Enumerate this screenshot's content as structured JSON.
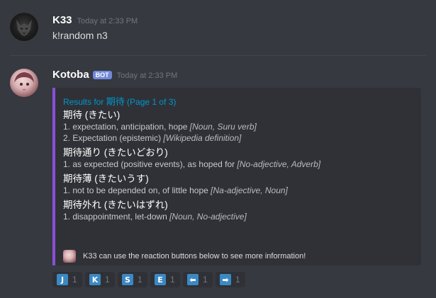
{
  "messages": [
    {
      "username": "K33",
      "timestamp": "Today at 2:33 PM",
      "content": "k!random n3"
    },
    {
      "username": "Kotoba",
      "bot_tag": "BOT",
      "timestamp": "Today at 2:33 PM",
      "embed": {
        "title_prefix": "Results for ",
        "title_query": "期待",
        "title_suffix": " (Page 1 of 3)",
        "accent_color": "#8a4fdb",
        "entries": [
          {
            "head": "期待 (きたい)",
            "defs": [
              {
                "text": "1. expectation, anticipation, hope ",
                "tag": "[Noun, Suru verb]"
              },
              {
                "text": "2. Expectation (epistemic) ",
                "tag": "[Wikipedia definition]"
              }
            ]
          },
          {
            "head": "期待通り (きたいどおり)",
            "defs": [
              {
                "text": "1. as expected (positive events), as hoped for ",
                "tag": "[No-adjective, Adverb]"
              }
            ]
          },
          {
            "head": "期待薄 (きたいうす)",
            "defs": [
              {
                "text": "1. not to be depended on, of little hope ",
                "tag": "[Na-adjective, Noun]"
              }
            ]
          },
          {
            "head": "期待外れ (きたいはずれ)",
            "defs": [
              {
                "text": "1. disappointment, let-down ",
                "tag": "[Noun, No-adjective]"
              }
            ]
          }
        ],
        "footer": "K33 can use the reaction buttons below to see more information!"
      },
      "reactions": [
        {
          "emoji": "J",
          "icon": "regional-j-icon",
          "count": "1"
        },
        {
          "emoji": "K",
          "icon": "regional-k-icon",
          "count": "1"
        },
        {
          "emoji": "S",
          "icon": "regional-s-icon",
          "count": "1"
        },
        {
          "emoji": "E",
          "icon": "regional-e-icon",
          "count": "1"
        },
        {
          "emoji": "⬅",
          "icon": "arrow-left-icon",
          "count": "1"
        },
        {
          "emoji": "➡",
          "icon": "arrow-right-icon",
          "count": "1"
        }
      ]
    }
  ]
}
